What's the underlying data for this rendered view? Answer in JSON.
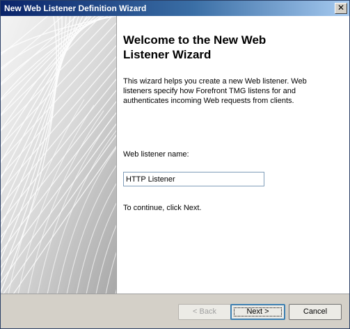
{
  "window": {
    "title": "New Web Listener Definition Wizard"
  },
  "titlebar": {
    "close_glyph": "✕"
  },
  "side_panel": {
    "graphic": "white-curved-grid-lines"
  },
  "content": {
    "heading_line1": "Welcome to the New Web",
    "heading_line2": "Listener Wizard",
    "description_line1": "This wizard helps you create a new Web listener. Web",
    "description_line2": "listeners specify how Forefront TMG listens for and",
    "description_line3": "authenticates incoming Web requests from clients.",
    "name_label": "Web listener name:",
    "name_value": "HTTP Listener",
    "continue_text": "To continue, click Next."
  },
  "buttons": {
    "back": "< Back",
    "next": "Next >",
    "cancel": "Cancel"
  }
}
